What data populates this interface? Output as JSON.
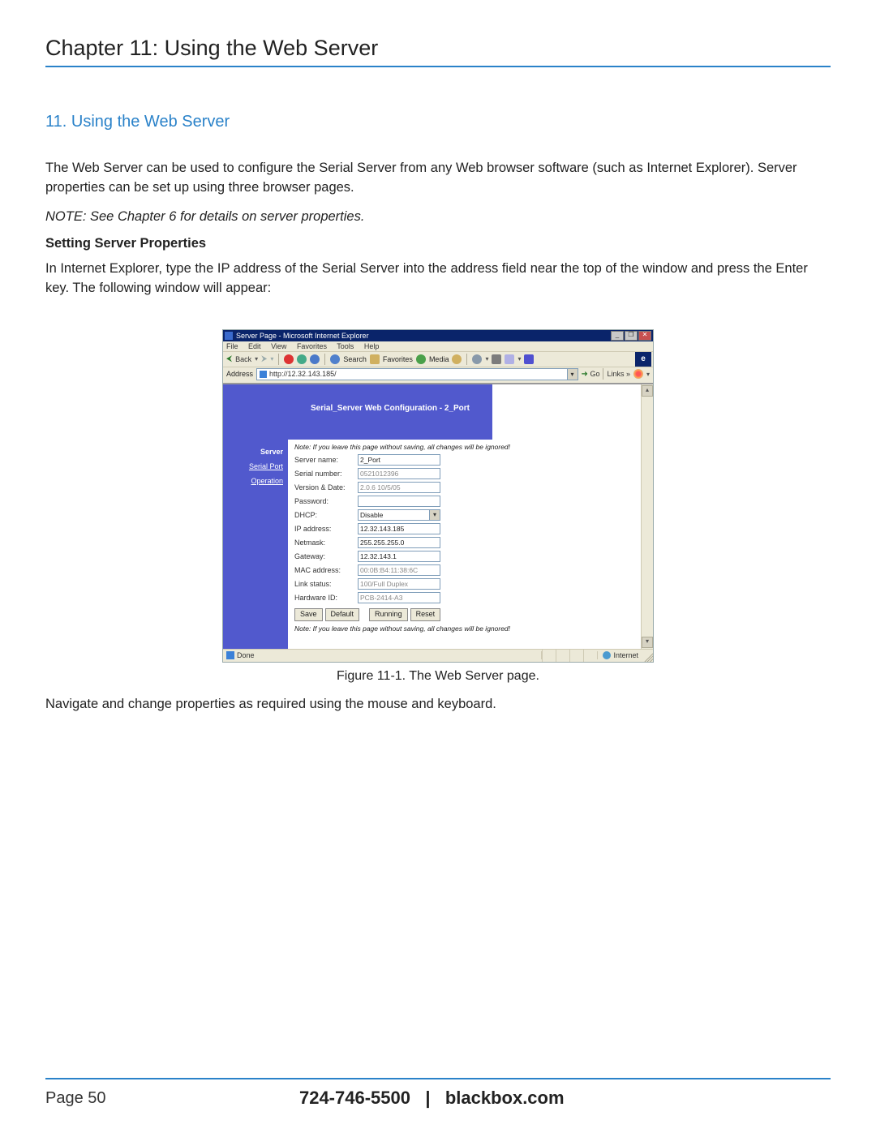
{
  "header": {
    "chapter_title": "Chapter 11: Using the Web Server",
    "section_title": "11. Using the Web Server"
  },
  "body": {
    "intro": "The Web Server can be used to configure the Serial Server from any Web browser software (such as Internet Explorer). Server properties can be set up using three browser pages.",
    "note": "NOTE: See Chapter 6 for details on server properties.",
    "subheading": "Setting Server Properties",
    "instructions": "In Internet Explorer, type the IP address of the Serial Server into the address field near the top of the window and press the Enter key. The following window will appear:",
    "after_figure": "Navigate and change properties as required using the mouse and keyboard."
  },
  "browser": {
    "titlebar": "Server Page - Microsoft Internet Explorer",
    "win_minimize": "_",
    "win_maximize": "❐",
    "win_close": "✕",
    "menu": {
      "file": "File",
      "edit": "Edit",
      "view": "View",
      "favorites": "Favorites",
      "tools": "Tools",
      "help": "Help"
    },
    "toolbar": {
      "back": "Back",
      "search": "Search",
      "favorites": "Favorites",
      "media": "Media",
      "ie_logo": "e"
    },
    "address_label": "Address",
    "address_value": "http://12.32.143.185/",
    "go": "Go",
    "links_label": "Links »",
    "status_done": "Done",
    "status_zone": "Internet"
  },
  "config": {
    "banner": "Serial_Server Web Configuration - 2_Port",
    "sidebar": {
      "server": "Server",
      "serial_port": "Serial Port",
      "operation": "Operation"
    },
    "warn_top": "Note: If you leave this page without saving, all changes will be ignored!",
    "warn_bottom": "Note: If you leave this page without saving, all changes will be ignored!",
    "labels": {
      "server_name": "Server name:",
      "serial_number": "Serial number:",
      "version_date": "Version & Date:",
      "password": "Password:",
      "dhcp": "DHCP:",
      "ip_address": "IP address:",
      "netmask": "Netmask:",
      "gateway": "Gateway:",
      "mac_address": "MAC address:",
      "link_status": "Link status:",
      "hardware_id": "Hardware ID:"
    },
    "values": {
      "server_name": "2_Port",
      "serial_number": "0521012396",
      "version_date": "2.0.6 10/5/05",
      "password": "",
      "dhcp": "Disable",
      "ip_address": "12.32.143.185",
      "netmask": "255.255.255.0",
      "gateway": "12.32.143.1",
      "mac_address": "00:0B:B4:11:38:6C",
      "link_status": "100/Full Duplex",
      "hardware_id": "PCB-2414-A3"
    },
    "buttons": {
      "save": "Save",
      "default": "Default",
      "running": "Running",
      "reset": "Reset"
    }
  },
  "figure_caption": "Figure 11-1. The Web Server page.",
  "footer": {
    "page": "Page 50",
    "phone": "724-746-5500",
    "sep": "|",
    "site": "blackbox.com"
  }
}
